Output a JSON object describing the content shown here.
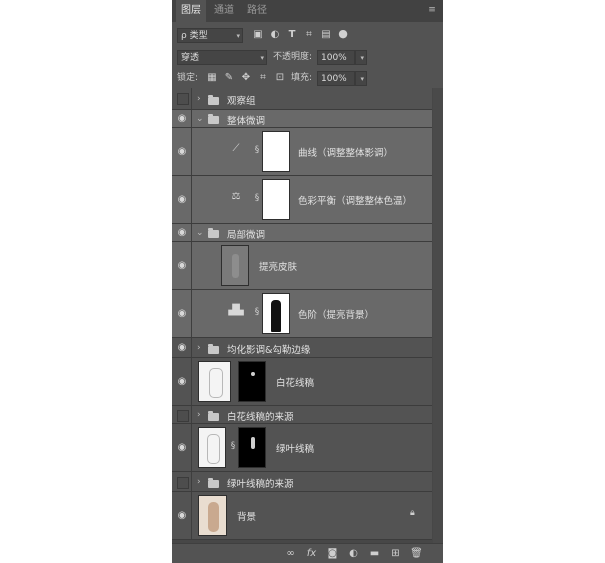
{
  "tabs": [
    {
      "label": "图层",
      "active": true
    },
    {
      "label": "通道",
      "active": false
    },
    {
      "label": "路径",
      "active": false
    }
  ],
  "filter": {
    "label": "ρ 类型"
  },
  "blend": {
    "mode": "穿透",
    "opacity_label": "不透明度:",
    "opacity_value": "100%"
  },
  "lock": {
    "label": "锁定:",
    "fill_label": "填充:",
    "fill_value": "100%"
  },
  "layers": [
    {
      "name": "观察组",
      "kind": "group",
      "visible": false
    },
    {
      "name": "整体微调",
      "kind": "group",
      "visible": true
    },
    {
      "name": "曲线（调整整体影调）",
      "kind": "adjustment",
      "adj": "curves",
      "visible": true
    },
    {
      "name": "色彩平衡（调整整体色温）",
      "kind": "adjustment",
      "adj": "color-balance",
      "visible": true
    },
    {
      "name": "局部微调",
      "kind": "group",
      "visible": true
    },
    {
      "name": "提亮皮肤",
      "kind": "pixel",
      "visible": true
    },
    {
      "name": "色阶（提亮背景）",
      "kind": "adjustment",
      "adj": "levels",
      "visible": true
    },
    {
      "name": "均化影调&勾勒边缘",
      "kind": "group",
      "visible": true
    },
    {
      "name": "白花线稿",
      "kind": "pixel-mask",
      "visible": true
    },
    {
      "name": "白花线稿的来源",
      "kind": "group",
      "visible": false
    },
    {
      "name": "绿叶线稿",
      "kind": "pixel-mask",
      "visible": true
    },
    {
      "name": "绿叶线稿的来源",
      "kind": "group",
      "visible": false
    },
    {
      "name": "背景",
      "kind": "background",
      "visible": true
    }
  ],
  "colors": {
    "panel": "#535353",
    "selected": "#696969",
    "tabbar": "#424242"
  }
}
